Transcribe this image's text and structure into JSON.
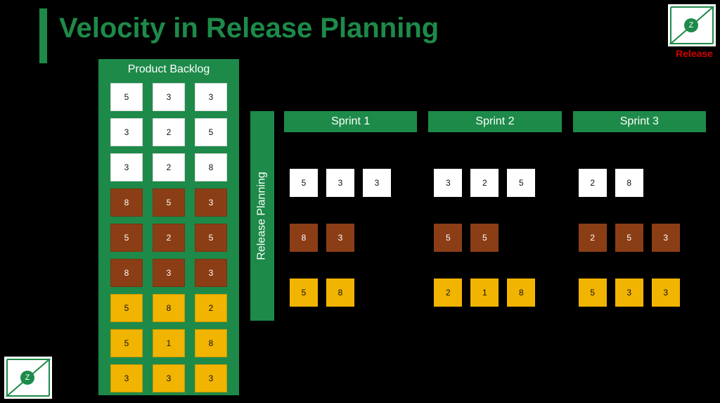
{
  "title": "Velocity in Release Planning",
  "backlog": {
    "header": "Product Backlog",
    "groups": [
      {
        "color": "white",
        "values": [
          "5",
          "3",
          "3",
          "3",
          "2",
          "5",
          "3",
          "2",
          "8"
        ]
      },
      {
        "color": "brown",
        "values": [
          "8",
          "5",
          "3",
          "5",
          "2",
          "5",
          "8",
          "3",
          "3"
        ]
      },
      {
        "color": "gold",
        "values": [
          "5",
          "8",
          "2",
          "5",
          "1",
          "8",
          "3",
          "3",
          "3"
        ]
      }
    ]
  },
  "releasePlanning": "Release Planning",
  "sprints": {
    "headers": [
      "Sprint 1",
      "Sprint 2",
      "Sprint 3"
    ],
    "rows": [
      {
        "color": "white",
        "cells": [
          [
            "5",
            "3",
            "3"
          ],
          [
            "3",
            "2",
            "5"
          ],
          [
            "2",
            "8"
          ]
        ]
      },
      {
        "color": "brown",
        "cells": [
          [
            "8",
            "3"
          ],
          [
            "5",
            "5"
          ],
          [
            "2",
            "5",
            "3"
          ]
        ]
      },
      {
        "color": "gold",
        "cells": [
          [
            "5",
            "8"
          ],
          [
            "2",
            "1",
            "8"
          ],
          [
            "5",
            "3",
            "3"
          ]
        ]
      }
    ]
  },
  "badge": {
    "letter": "Z"
  },
  "releaseLabel": "Release"
}
